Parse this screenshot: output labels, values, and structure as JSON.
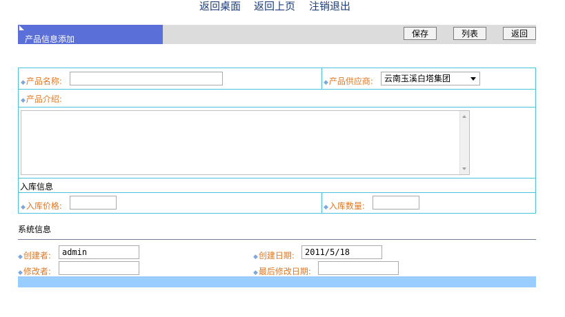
{
  "nav": {
    "desktop": "返回桌面",
    "prev_page": "返回上页",
    "logout": "注销退出"
  },
  "title_bar": {
    "title": "产品信息添加",
    "save": "保存",
    "list": "列表",
    "back": "返回"
  },
  "form": {
    "product_name_label": "产品名称:",
    "product_name_value": "",
    "supplier_label": "产品供应商:",
    "supplier_selected": "云南玉溪白塔集团",
    "intro_label": "产品介绍:",
    "intro_value": "",
    "stock_section": "入库信息",
    "stock_price_label": "入库价格:",
    "stock_price_value": "",
    "stock_qty_label": "入库数量:",
    "stock_qty_value": ""
  },
  "system": {
    "section_title": "系统信息",
    "creator_label": "创建者:",
    "creator_value": "admin",
    "created_date_label": "创建日期:",
    "created_date_value": "2011/5/18",
    "modifier_label": "修改者:",
    "modifier_value": "",
    "modified_date_label": "最后修改日期:",
    "modified_date_value": ""
  },
  "colors": {
    "title_tab": "#5a6fd8",
    "label_orange": "#e07822",
    "border_cyan": "#49c2dc",
    "footer_bar": "#99ccff"
  }
}
